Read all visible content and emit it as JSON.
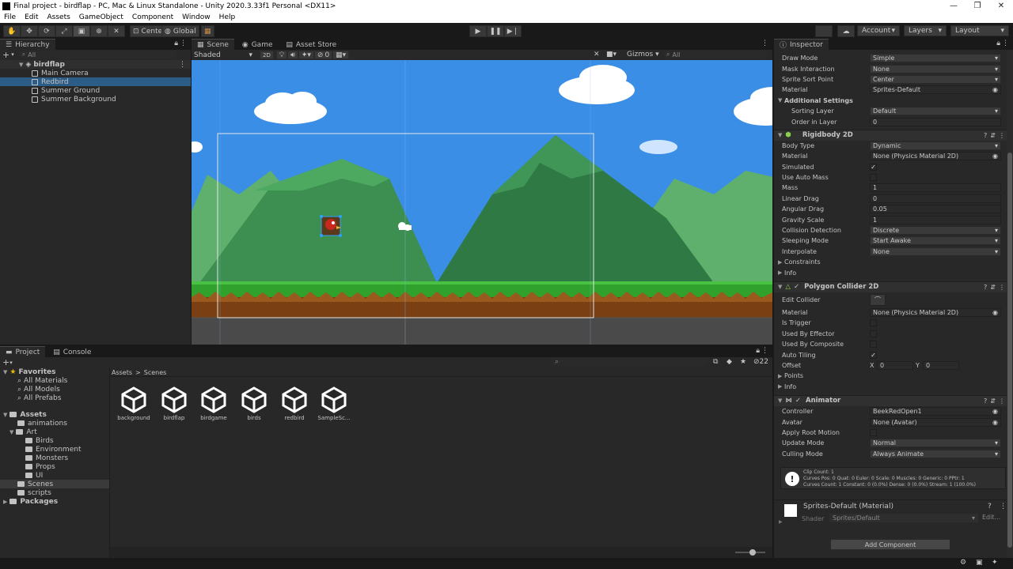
{
  "window": {
    "title": "Final project - birdflap - PC, Mac & Linux Standalone - Unity 2020.3.33f1 Personal <DX11>"
  },
  "menu": [
    "File",
    "Edit",
    "Assets",
    "GameObject",
    "Component",
    "Window",
    "Help"
  ],
  "toolbar": {
    "pivot_label": "Center",
    "space_label": "Global",
    "account_label": "Account",
    "layers_label": "Layers",
    "layout_label": "Layout"
  },
  "hierarchy": {
    "tab_label": "Hierarchy",
    "search_placeholder": "All",
    "scene_name": "birdflap",
    "items": [
      "Main Camera",
      "Redbird",
      "Summer Ground",
      "Summer Background"
    ],
    "selected": "Redbird"
  },
  "scene": {
    "tabs": [
      "Scene",
      "Game",
      "Asset Store"
    ],
    "shading_mode": "Shaded",
    "mode_2d": "2D",
    "hidden_count": "0",
    "gizmos_label": "Gizmos",
    "search_placeholder": "All"
  },
  "project": {
    "tabs": [
      "Project",
      "Console"
    ],
    "breadcrumb_root": "Assets",
    "breadcrumb_sep": ">",
    "breadcrumb_current": "Scenes",
    "hidden_count": "22",
    "favorites_label": "Favorites",
    "favorites": [
      "All Materials",
      "All Models",
      "All Prefabs"
    ],
    "assets_label": "Assets",
    "tree_animations": "animations",
    "tree_art": "Art",
    "art_children": [
      "Birds",
      "Environment",
      "Monsters",
      "Props",
      "UI"
    ],
    "tree_scenes": "Scenes",
    "tree_scripts": "scripts",
    "packages_label": "Packages",
    "scene_files": [
      "background",
      "birdflap",
      "birdgame",
      "birds",
      "redbird",
      "SampleSc..."
    ]
  },
  "inspector": {
    "tab_label": "Inspector",
    "sprite_renderer": [
      {
        "label": "Draw Mode",
        "value": "Simple",
        "type": "dropdown"
      },
      {
        "label": "Mask Interaction",
        "value": "None",
        "type": "dropdown"
      },
      {
        "label": "Sprite Sort Point",
        "value": "Center",
        "type": "dropdown"
      },
      {
        "label": "Material",
        "value": "Sprites-Default",
        "type": "object"
      }
    ],
    "additional_settings_label": "Additional Settings",
    "additional_settings": [
      {
        "label": "Sorting Layer",
        "value": "Default",
        "type": "dropdown"
      },
      {
        "label": "Order in Layer",
        "value": "0",
        "type": "field"
      }
    ],
    "rigidbody": {
      "title": "Rigidbody 2D",
      "props": [
        {
          "label": "Body Type",
          "value": "Dynamic",
          "type": "dropdown"
        },
        {
          "label": "Material",
          "value": "None (Physics Material 2D)",
          "type": "object"
        },
        {
          "label": "Simulated",
          "value": "✓",
          "type": "check"
        },
        {
          "label": "Use Auto Mass",
          "value": "",
          "type": "check"
        },
        {
          "label": "Mass",
          "value": "1",
          "type": "field"
        },
        {
          "label": "Linear Drag",
          "value": "0",
          "type": "field"
        },
        {
          "label": "Angular Drag",
          "value": "0.05",
          "type": "field"
        },
        {
          "label": "Gravity Scale",
          "value": "1",
          "type": "field"
        },
        {
          "label": "Collision Detection",
          "value": "Discrete",
          "type": "dropdown"
        },
        {
          "label": "Sleeping Mode",
          "value": "Start Awake",
          "type": "dropdown"
        },
        {
          "label": "Interpolate",
          "value": "None",
          "type": "dropdown"
        }
      ],
      "constraints_label": "Constraints",
      "info_label": "Info"
    },
    "polygon_collider": {
      "title": "Polygon Collider 2D",
      "edit_collider_label": "Edit Collider",
      "props": [
        {
          "label": "Material",
          "value": "None (Physics Material 2D)",
          "type": "object"
        },
        {
          "label": "Is Trigger",
          "value": "",
          "type": "check"
        },
        {
          "label": "Used By Effector",
          "value": "",
          "type": "check"
        },
        {
          "label": "Used By Composite",
          "value": "",
          "type": "check"
        },
        {
          "label": "Auto Tiling",
          "value": "✓",
          "type": "check"
        }
      ],
      "offset_label": "Offset",
      "offset_x_label": "X",
      "offset_x": "0",
      "offset_y_label": "Y",
      "offset_y": "0",
      "points_label": "Points",
      "info_label": "Info"
    },
    "animator": {
      "title": "Animator",
      "props": [
        {
          "label": "Controller",
          "value": "BeekRedOpen1",
          "type": "object"
        },
        {
          "label": "Avatar",
          "value": "None (Avatar)",
          "type": "object"
        },
        {
          "label": "Apply Root Motion",
          "value": "",
          "type": "check"
        },
        {
          "label": "Update Mode",
          "value": "Normal",
          "type": "dropdown"
        },
        {
          "label": "Culling Mode",
          "value": "Always Animate",
          "type": "dropdown"
        }
      ],
      "info_lines": [
        "Clip Count: 1",
        "Curves Pos: 0 Quat: 0 Euler: 0 Scale: 0 Muscles: 0 Generic: 0 PPtr: 1",
        "Curves Count: 1 Constant: 0 (0.0%) Dense: 0 (0.0%) Stream: 1 (100.0%)"
      ]
    },
    "material": {
      "title": "Sprites-Default (Material)",
      "shader_label": "Shader",
      "shader_value": "Sprites/Default",
      "edit_label": "Edit..."
    },
    "add_component_label": "Add Component"
  },
  "colors": {
    "sky": "#3b8ee6",
    "mountain_dark": "#2f7a44",
    "mountain_light": "#5fb06d",
    "grass": "#2fa12c",
    "dirt": "#7a3f12",
    "selection": "#2c5d87"
  }
}
